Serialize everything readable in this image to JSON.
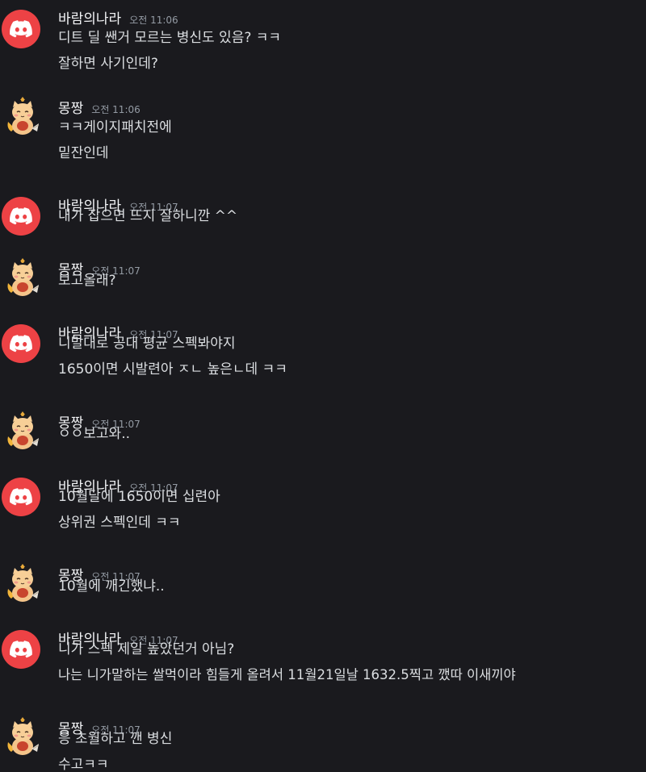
{
  "users": {
    "a": {
      "name": "바람의나라",
      "avatar_icon": "discord-logo-icon",
      "avatar_color": "#ed4245"
    },
    "b": {
      "name": "몽짱",
      "avatar_icon": "cat-mascot-icon"
    }
  },
  "messages": [
    {
      "user": "바람의나라",
      "time": "오전 11:06",
      "lines": [
        "디트 딜 쌘거 모르는 병신도 있음? ㅋㅋ",
        "잘하면 사기인데?"
      ]
    },
    {
      "user": "몽짱",
      "time": "오전 11:06",
      "lines": [
        "ㅋㅋ게이지패치전에",
        "밑잔인데"
      ]
    },
    {
      "user": "바람의나라",
      "time": "오전 11:07",
      "lines": [
        "내가 잡으면 뜨지 잘하니깐 ^^"
      ]
    },
    {
      "user": "몽짱",
      "time": "오전 11:07",
      "lines": [
        "보고올래?"
      ]
    },
    {
      "user": "바람의나라",
      "time": "오전 11:07",
      "lines": [
        "니말대로 공대 평균 스펙봐야지",
        "1650이면 시발련아 ㅈㄴ 높은ㄴ데 ㅋㅋ"
      ]
    },
    {
      "user": "몽짱",
      "time": "오전 11:07",
      "lines": [
        "ㅇㅇ보고와.."
      ]
    },
    {
      "user": "바람의나라",
      "time": "오전 11:07",
      "lines": [
        "10월달에 1650이면 십련아",
        "상위권 스펙인데 ㅋㅋ"
      ]
    },
    {
      "user": "몽짱",
      "time": "오전 11:07",
      "lines": [
        "10월에 깨긴했냐.."
      ]
    },
    {
      "user": "바람의나라",
      "time": "오전 11:07",
      "lines": [
        "니가 스펙 제일 높았던거 아님?",
        "나는 니가말하는 쌀먹이라 힘들게 올려서 11월21일날 1632.5찍고 깼따 이새끼야"
      ]
    },
    {
      "user": "몽짱",
      "time": "오전 11:07",
      "lines": [
        "응 초월하고 깬 병신",
        "수고ㅋㅋ"
      ]
    }
  ]
}
